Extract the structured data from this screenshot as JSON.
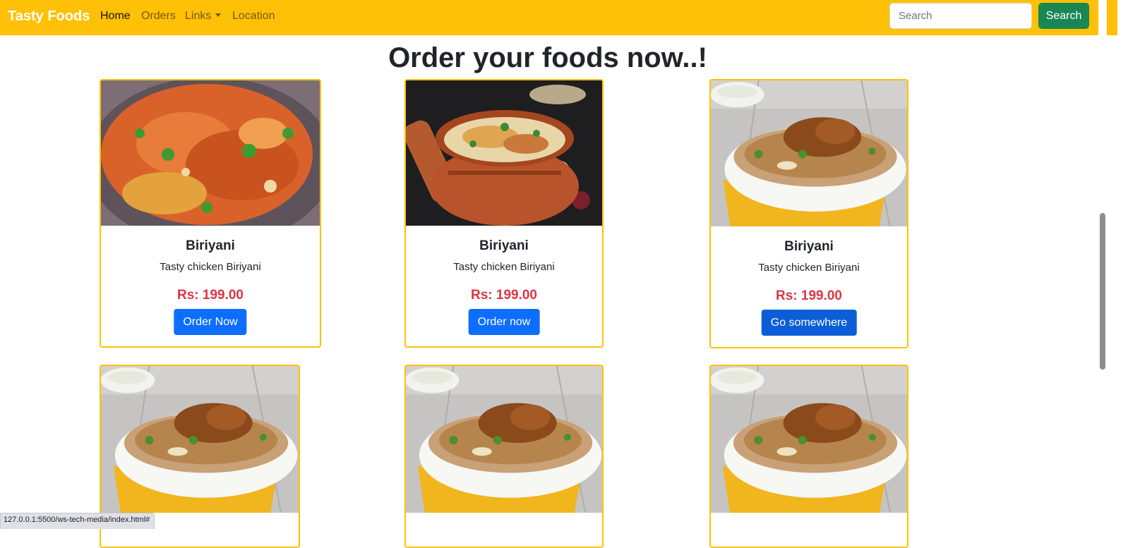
{
  "navbar": {
    "brand": "Tasty Foods",
    "links": [
      {
        "label": "Home",
        "active": true
      },
      {
        "label": "Orders"
      },
      {
        "label": "Links",
        "dropdown": true
      },
      {
        "label": "Location"
      }
    ],
    "search_placeholder": "Search",
    "search_button": "Search"
  },
  "main": {
    "heading": "Order your foods now..!"
  },
  "cards": [
    {
      "title": "Biriyani",
      "text": "Tasty chicken Biriyani",
      "price": "Rs: 199.00",
      "button": "Order Now"
    },
    {
      "title": "Biriyani",
      "text": "Tasty chicken Biriyani",
      "price": "Rs: 199.00",
      "button": "Order now"
    },
    {
      "title": "Biriyani",
      "text": "Tasty chicken Biriyani",
      "price": "Rs: 199.00",
      "button": "Go somewhere"
    }
  ],
  "status_bar": {
    "url": "127.0.0.1:5500/ws-tech-media/index.html#"
  },
  "colors": {
    "navbar": "#ffc107",
    "search_button": "#198754",
    "order_button": "#0d6efd",
    "price": "#dc3545",
    "card_border": "#ffc107"
  }
}
